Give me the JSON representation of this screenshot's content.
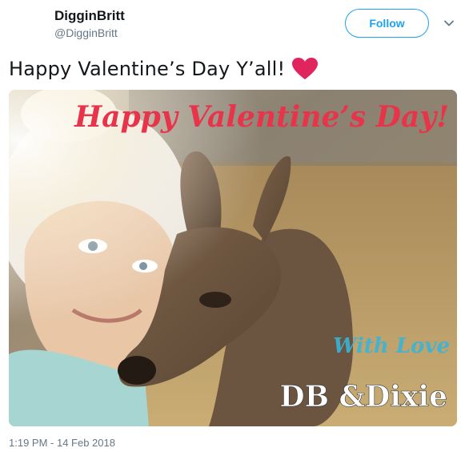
{
  "author": {
    "display_name": "DigginBritt",
    "handle": "@DigginBritt"
  },
  "follow_label": "Follow",
  "tweet": {
    "text": "Happy Valentine’s Day Y’all!",
    "emoji": "heart-emoji",
    "timestamp": "1:19 PM - 14 Feb 2018"
  },
  "media": {
    "overlay_title": "Happy Valentine’s Day!",
    "overlay_subtitle": "With Love",
    "overlay_names": "DB &Dixie"
  },
  "colors": {
    "accent": "#1da1f2",
    "heart": "#e0245e",
    "overlay_red": "#e8344a",
    "overlay_teal": "#3ab4d8",
    "text_secondary": "#657786"
  }
}
